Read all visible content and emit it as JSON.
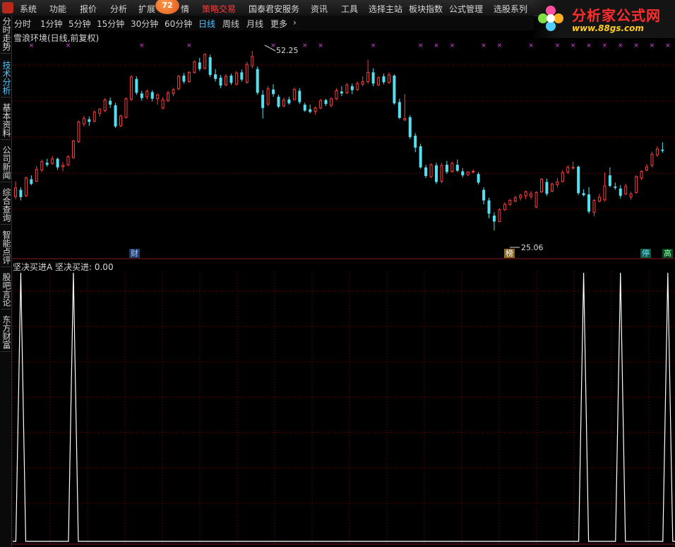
{
  "menu": {
    "items": [
      "系统",
      "功能",
      "报价",
      "分析",
      "扩展",
      "情",
      "策略交易",
      "国泰君安服务",
      "资讯",
      "工具",
      "选择主站",
      "板块指数",
      "公式管理",
      "选股系列"
    ],
    "badge": "72",
    "hot_color": "#ff3a3a"
  },
  "logo": {
    "title": "分析家公式网",
    "url": "www.88gs.com"
  },
  "period_tabs": [
    "分时",
    "1分钟",
    "5分钟",
    "15分钟",
    "30分钟",
    "60分钟",
    "日线",
    "周线",
    "月线",
    "更多"
  ],
  "active_period": "日线",
  "side_tabs": [
    "分时走势",
    "技术分析",
    "基本资料",
    "公司新闻",
    "综合查询",
    "智能点评",
    "股吧言论",
    "东方财富"
  ],
  "active_side_tab": "技术分析",
  "main_title": "雪浪环境(日线,前复权)",
  "indicator_title": "坚决买进A",
  "indicator_value_text": "坚决买进: 0.00",
  "tags": {
    "cai": "财",
    "bang": "榜",
    "ting": "停",
    "gao": "高"
  },
  "icons": {
    "more": "chevron-right-icon",
    "flower": "flower-logo-icon"
  },
  "colors": {
    "up": "#ff3b3b",
    "down": "#54e0f0",
    "marker": "#e040e0",
    "signal": "#ffffff",
    "grid": "#6e1010"
  },
  "chart_data": [
    {
      "type": "candlestick",
      "title": "雪浪环境(日线,前复权)",
      "high_label": "52.25",
      "low_label": "25.06",
      "candles": [
        [
          30.2,
          32.5,
          29.8,
          31.5
        ],
        [
          31.2,
          31.6,
          29.6,
          30.1
        ],
        [
          30.3,
          33.2,
          30.1,
          33.0
        ],
        [
          32.8,
          33.4,
          31.9,
          32.1
        ],
        [
          32.5,
          34.8,
          32.4,
          34.3
        ],
        [
          34.2,
          35.8,
          33.9,
          35.5
        ],
        [
          35.3,
          35.9,
          34.7,
          35.0
        ],
        [
          35.2,
          36.3,
          35.0,
          35.9
        ],
        [
          35.9,
          36.1,
          34.2,
          34.6
        ],
        [
          34.7,
          35.4,
          34.0,
          34.9
        ],
        [
          35.0,
          36.4,
          34.8,
          36.2
        ],
        [
          36.1,
          38.8,
          35.9,
          38.6
        ],
        [
          38.5,
          41.7,
          38.3,
          41.5
        ],
        [
          41.2,
          42.4,
          40.8,
          42.0
        ],
        [
          41.9,
          42.3,
          40.9,
          41.5
        ],
        [
          41.6,
          43.2,
          41.4,
          43.0
        ],
        [
          42.8,
          43.6,
          42.3,
          43.4
        ],
        [
          43.2,
          45.1,
          43.0,
          44.8
        ],
        [
          44.7,
          45.2,
          43.6,
          44.1
        ],
        [
          44.0,
          44.4,
          40.6,
          40.8
        ],
        [
          40.9,
          42.6,
          40.7,
          42.4
        ],
        [
          42.2,
          45.2,
          42.0,
          45.0
        ],
        [
          44.9,
          48.6,
          44.7,
          48.3
        ],
        [
          48.0,
          48.4,
          45.6,
          45.9
        ],
        [
          45.8,
          46.2,
          44.7,
          45.1
        ],
        [
          45.3,
          46.4,
          44.9,
          46.1
        ],
        [
          46.0,
          46.3,
          44.6,
          45.0
        ],
        [
          45.0,
          45.8,
          44.1,
          45.6
        ],
        [
          43.6,
          45.2,
          43.4,
          44.8
        ],
        [
          44.7,
          46.2,
          44.5,
          45.9
        ],
        [
          45.8,
          46.6,
          45.4,
          46.4
        ],
        [
          46.5,
          48.6,
          46.3,
          48.4
        ],
        [
          48.5,
          48.9,
          47.3,
          47.6
        ],
        [
          47.6,
          49.2,
          47.4,
          49.0
        ],
        [
          49.0,
          50.8,
          48.8,
          50.6
        ],
        [
          50.5,
          51.2,
          49.2,
          49.5
        ],
        [
          49.6,
          51.9,
          49.4,
          51.7
        ],
        [
          51.3,
          51.7,
          48.3,
          48.6
        ],
        [
          48.7,
          49.5,
          47.6,
          48.0
        ],
        [
          48.2,
          48.6,
          46.6,
          47.0
        ],
        [
          47.1,
          48.7,
          46.9,
          48.4
        ],
        [
          48.5,
          48.8,
          47.1,
          47.4
        ],
        [
          47.2,
          49.2,
          47.0,
          48.9
        ],
        [
          49.0,
          49.4,
          47.6,
          47.9
        ],
        [
          47.5,
          50.6,
          47.3,
          50.2
        ],
        [
          50.0,
          52.25,
          49.6,
          51.4
        ],
        [
          49.5,
          49.9,
          45.6,
          45.9
        ],
        [
          45.6,
          46.3,
          42.0,
          43.6
        ],
        [
          44.2,
          46.9,
          43.9,
          46.5
        ],
        [
          46.4,
          47.2,
          45.3,
          45.7
        ],
        [
          45.3,
          45.6,
          43.6,
          43.8
        ],
        [
          43.9,
          45.2,
          43.7,
          44.8
        ],
        [
          44.9,
          45.3,
          44.1,
          44.3
        ],
        [
          44.9,
          46.7,
          44.7,
          46.4
        ],
        [
          46.2,
          46.6,
          44.2,
          44.5
        ],
        [
          44.1,
          44.4,
          43.0,
          43.2
        ],
        [
          43.4,
          44.1,
          42.8,
          43.0
        ],
        [
          43.1,
          43.8,
          42.6,
          43.6
        ],
        [
          43.6,
          45.0,
          43.4,
          44.7
        ],
        [
          44.8,
          45.0,
          43.9,
          44.2
        ],
        [
          44.0,
          45.2,
          43.7,
          45.0
        ],
        [
          45.0,
          46.6,
          44.8,
          46.2
        ],
        [
          46.1,
          46.9,
          45.4,
          45.8
        ],
        [
          45.9,
          47.4,
          45.7,
          47.1
        ],
        [
          46.9,
          47.3,
          45.7,
          46.3
        ],
        [
          46.4,
          47.6,
          46.2,
          47.3
        ],
        [
          47.2,
          48.4,
          46.9,
          47.6
        ],
        [
          47.6,
          50.9,
          47.3,
          49.0
        ],
        [
          49.0,
          49.6,
          46.9,
          47.3
        ],
        [
          47.1,
          48.4,
          46.9,
          48.2
        ],
        [
          48.4,
          48.8,
          47.2,
          47.5
        ],
        [
          47.5,
          49.0,
          47.2,
          48.6
        ],
        [
          48.5,
          48.7,
          44.1,
          44.3
        ],
        [
          44.5,
          45.0,
          41.9,
          42.1
        ],
        [
          41.8,
          45.7,
          41.6,
          42.0
        ],
        [
          42.2,
          42.5,
          38.9,
          39.2
        ],
        [
          39.4,
          39.8,
          36.9,
          37.6
        ],
        [
          37.8,
          38.2,
          34.4,
          34.6
        ],
        [
          34.6,
          35.0,
          33.0,
          33.3
        ],
        [
          33.2,
          35.2,
          33.0,
          35.0
        ],
        [
          34.9,
          35.3,
          32.1,
          32.4
        ],
        [
          32.5,
          35.3,
          32.2,
          34.9
        ],
        [
          35.0,
          35.6,
          33.6,
          33.9
        ],
        [
          34.0,
          35.5,
          33.8,
          35.2
        ],
        [
          35.0,
          35.8,
          33.9,
          34.1
        ],
        [
          34.0,
          34.5,
          33.1,
          33.4
        ],
        [
          33.5,
          34.0,
          33.3,
          33.9
        ],
        [
          33.9,
          34.3,
          33.7,
          34.0
        ],
        [
          33.6,
          33.9,
          32.0,
          32.3
        ],
        [
          31.2,
          31.6,
          29.0,
          29.6
        ],
        [
          29.6,
          30.0,
          26.9,
          27.6
        ],
        [
          27.3,
          27.8,
          25.06,
          26.4
        ],
        [
          26.4,
          28.4,
          26.3,
          28.2
        ],
        [
          28.2,
          29.3,
          28.0,
          29.0
        ],
        [
          29.0,
          29.8,
          28.8,
          29.6
        ],
        [
          29.5,
          30.3,
          29.3,
          30.0
        ],
        [
          30.0,
          30.6,
          29.6,
          30.4
        ],
        [
          30.3,
          31.1,
          29.8,
          30.9
        ],
        [
          30.2,
          31.0,
          29.8,
          30.6
        ],
        [
          28.6,
          31.0,
          28.4,
          30.8
        ],
        [
          30.9,
          33.0,
          30.7,
          32.8
        ],
        [
          32.4,
          32.9,
          30.3,
          30.6
        ],
        [
          31.0,
          32.3,
          30.8,
          32.1
        ],
        [
          32.0,
          33.0,
          31.6,
          32.4
        ],
        [
          32.5,
          34.2,
          32.3,
          33.8
        ],
        [
          33.9,
          34.9,
          33.6,
          34.6
        ],
        [
          34.5,
          35.5,
          34.3,
          34.6
        ],
        [
          34.7,
          34.9,
          30.4,
          30.7
        ],
        [
          30.7,
          31.3,
          30.2,
          30.4
        ],
        [
          30.5,
          31.6,
          27.6,
          27.9
        ],
        [
          27.8,
          29.8,
          27.2,
          29.6
        ],
        [
          29.5,
          30.6,
          29.3,
          30.1
        ],
        [
          29.7,
          33.8,
          29.4,
          31.8
        ],
        [
          33.4,
          34.6,
          31.6,
          31.8
        ],
        [
          31.7,
          32.3,
          31.2,
          31.5
        ],
        [
          31.4,
          31.9,
          29.9,
          30.3
        ],
        [
          30.6,
          32.1,
          30.4,
          31.7
        ],
        [
          30.1,
          30.9,
          29.7,
          30.6
        ],
        [
          30.8,
          33.4,
          30.6,
          33.2
        ],
        [
          33.0,
          34.2,
          32.7,
          34.0
        ],
        [
          34.2,
          35.1,
          34.0,
          34.7
        ],
        [
          34.9,
          37.0,
          34.6,
          36.6
        ],
        [
          36.5,
          37.8,
          36.2,
          37.4
        ],
        [
          37.3,
          38.4,
          36.8,
          37.1
        ]
      ],
      "signal_marker_candle_indices": [
        3,
        10,
        24,
        33,
        49,
        55,
        58,
        68,
        77,
        80,
        83,
        89,
        92,
        98,
        103,
        106,
        109,
        112,
        115,
        118,
        121,
        124
      ]
    },
    {
      "type": "line",
      "title": "坚决买进A",
      "series": [
        {
          "name": "坚决买进",
          "spikes_at_candle": [
            1,
            11,
            108,
            115,
            124
          ],
          "spike_value": 1,
          "base_value": 0
        }
      ],
      "last_value": 0.0
    }
  ]
}
